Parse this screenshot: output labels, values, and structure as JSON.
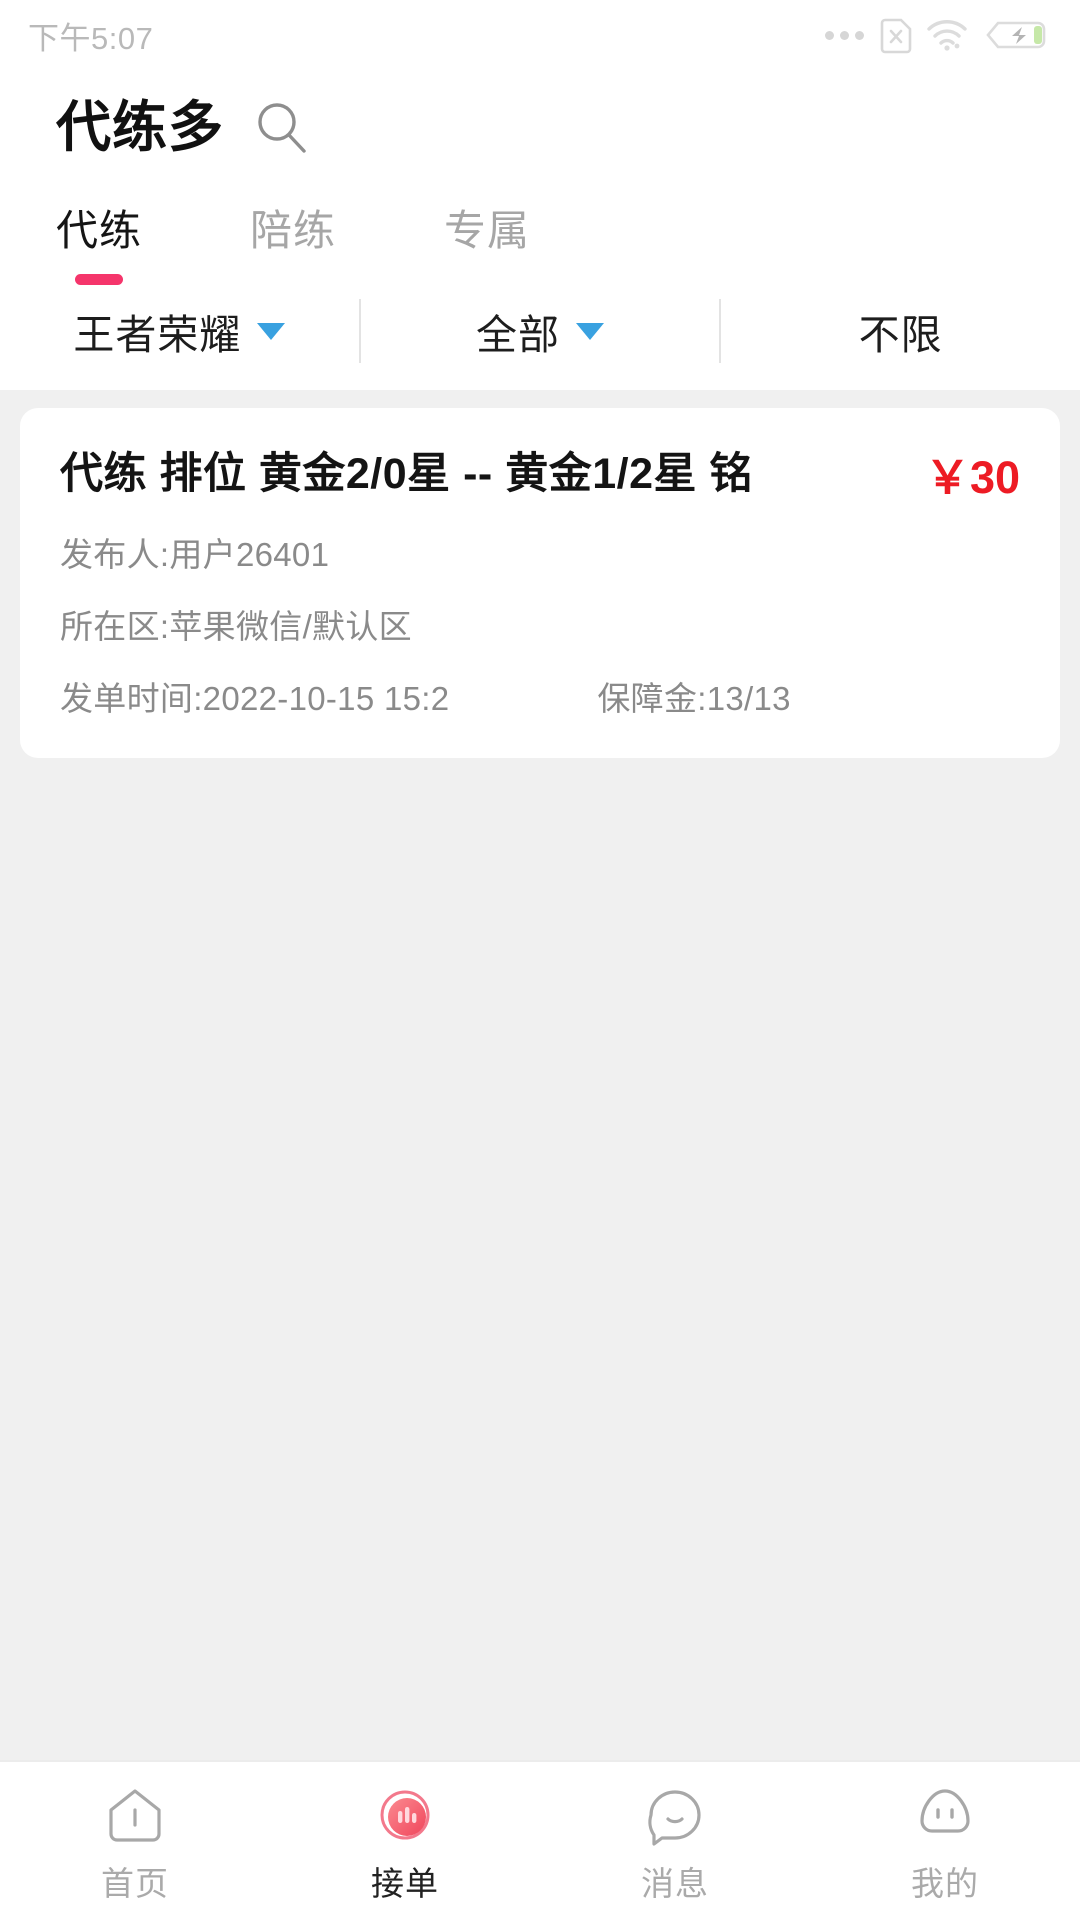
{
  "status_bar": {
    "time": "下午5:07",
    "icons": [
      "more-dots-icon",
      "sim-card-disabled-icon",
      "wifi-icon",
      "battery-charging-icon"
    ]
  },
  "header": {
    "app_title": "代练多",
    "search_icon": "search-icon"
  },
  "tabs": [
    {
      "label": "代练",
      "active": true
    },
    {
      "label": "陪练",
      "active": false
    },
    {
      "label": "专属",
      "active": false
    }
  ],
  "filters": [
    {
      "label": "王者荣耀",
      "has_caret": true
    },
    {
      "label": "全部",
      "has_caret": true
    },
    {
      "label": "不限",
      "has_caret": false
    }
  ],
  "orders": [
    {
      "title": "代练 排位 黄金2/0星 -- 黄金1/2星 铭",
      "price": "￥30",
      "publisher": "发布人:用户26401",
      "region": "所在区:苹果微信/默认区",
      "time": "发单时间:2022-10-15 15:2",
      "deposit": "保障金:13/13"
    }
  ],
  "bottom_nav": [
    {
      "label": "首页",
      "icon": "home-icon",
      "active": false
    },
    {
      "label": "接单",
      "icon": "take-order-icon",
      "active": true
    },
    {
      "label": "消息",
      "icon": "message-icon",
      "active": false
    },
    {
      "label": "我的",
      "icon": "profile-icon",
      "active": false
    }
  ],
  "colors": {
    "accent_pink": "#f5356b",
    "price_red": "#ed1b24",
    "caret_blue": "#39a1e0",
    "page_bg": "#f0f0f0"
  }
}
